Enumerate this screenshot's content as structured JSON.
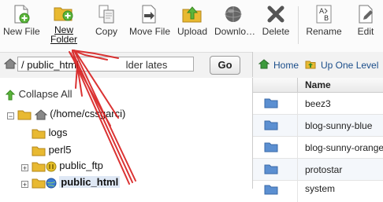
{
  "toolbar": {
    "new_file": "New File",
    "new_folder_line1": "New",
    "new_folder_line2": "Folder",
    "copy": "Copy",
    "move_file": "Move File",
    "upload": "Upload",
    "download": "Downlo…",
    "delete": "Delete",
    "rename": "Rename",
    "edit": "Edit"
  },
  "path_bar": {
    "input_value": "/ public_html",
    "obscured_text": "lder lates",
    "go_label": "Go"
  },
  "file_nav": {
    "home_label": "Home",
    "up_label": "Up One Level"
  },
  "tree": {
    "collapse_label": "Collapse All",
    "root_label": "(/home/cssgarci)",
    "items": [
      {
        "label": "logs"
      },
      {
        "label": "perl5"
      },
      {
        "label": "public_ftp"
      },
      {
        "label": "public_html"
      }
    ]
  },
  "file_list": {
    "name_header": "Name",
    "rows": [
      {
        "name": "beez3"
      },
      {
        "name": "blog-sunny-blue"
      },
      {
        "name": "blog-sunny-orange"
      },
      {
        "name": "protostar"
      },
      {
        "name": "system"
      }
    ]
  },
  "colors": {
    "folder": "#e8b931",
    "folder_blue": "#5b8fd1",
    "arrow": "#d81e1e",
    "link": "#1a4d8a"
  },
  "icons": {
    "new_file": "new-file-icon",
    "new_folder": "new-folder-icon",
    "copy": "copy-icon",
    "move_file": "move-file-icon",
    "upload": "upload-icon",
    "download": "download-icon",
    "delete": "delete-icon",
    "rename": "rename-icon",
    "edit": "edit-icon"
  }
}
